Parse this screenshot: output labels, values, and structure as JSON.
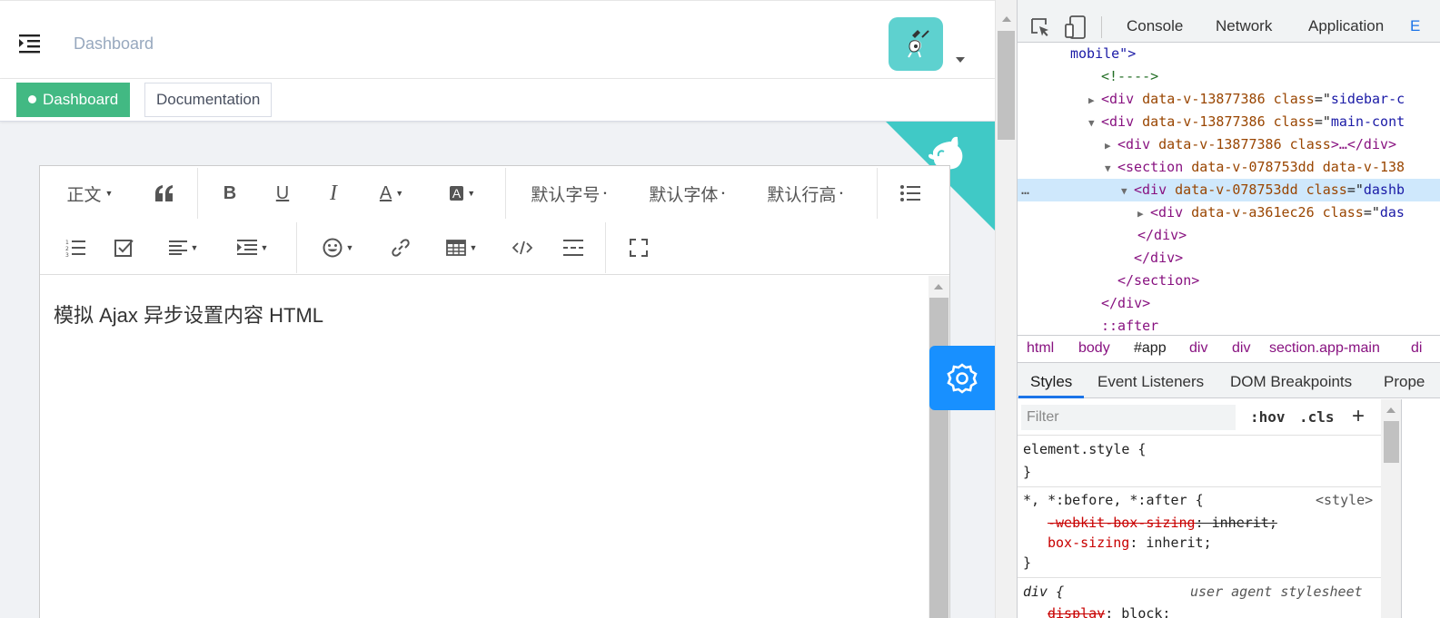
{
  "navbar": {
    "breadcrumb": "Dashboard"
  },
  "tags": {
    "items": [
      {
        "label": "Dashboard",
        "active": true
      },
      {
        "label": "Documentation",
        "active": false
      }
    ]
  },
  "editor": {
    "toolbar": {
      "heading": "正文",
      "quote_icon": "quote-icon",
      "bold": "B",
      "underline": "U",
      "italic": "I",
      "font_color": "A",
      "bg_color": "A",
      "font_size": "默认字号",
      "font_family": "默认字体",
      "line_height": "默认行高",
      "list_icon": "bullet-list-icon",
      "row2_icons": [
        "ordered-list-icon",
        "todo-icon",
        "justify-icon",
        "indent-icon",
        "emotion-icon",
        "link-icon",
        "table-icon",
        "code-icon",
        "divider-icon",
        "fullscreen-icon"
      ]
    },
    "content": "模拟 Ajax 异步设置内容 HTML"
  },
  "colors": {
    "accent_green": "#42b983",
    "settings_blue": "#1890ff",
    "github_teal": "#40c9c6",
    "avatar_bg": "#5ed1cf"
  },
  "devtools": {
    "tabs": [
      "Console",
      "Network",
      "Application",
      "E"
    ],
    "dom": [
      {
        "indent": 58,
        "text": "mobile\">"
      },
      {
        "indent": 92,
        "comment": "<!---->"
      },
      {
        "indent": 78,
        "tri": "▶",
        "tag": "div",
        "attr": "data-v-13877386 class",
        "val": "sidebar-c"
      },
      {
        "indent": 78,
        "tri": "▼",
        "tag": "div",
        "attr": "data-v-13877386 class",
        "val": "main-cont"
      },
      {
        "indent": 96,
        "tri": "▶",
        "tag": "div",
        "attr": "data-v-13877386 class",
        "tail": ">…</div>"
      },
      {
        "indent": 96,
        "tri": "▼",
        "tag": "section",
        "attr": "data-v-078753dd data-v-138",
        "val": ""
      },
      {
        "indent": 114,
        "tri": "▼",
        "tag": "div",
        "attr": "data-v-078753dd class",
        "val": "dashb",
        "selected": true
      },
      {
        "indent": 132,
        "tri": "▶",
        "tag": "div",
        "attr": "data-v-a361ec26 class",
        "val": "das"
      },
      {
        "indent": 132,
        "close": "</div>"
      },
      {
        "indent": 128,
        "close": "</div>"
      },
      {
        "indent": 110,
        "close": "</section>"
      },
      {
        "indent": 92,
        "close": "</div>"
      },
      {
        "indent": 92,
        "pseudo": "::after"
      }
    ],
    "dom_dots": "…",
    "crumbs": [
      "html",
      "body",
      "#app",
      "div",
      "div",
      "section.app-main",
      "di"
    ],
    "styles_tabs": [
      "Styles",
      "Event Listeners",
      "DOM Breakpoints",
      "Prope"
    ],
    "filter_placeholder": "Filter",
    "hov": ":hov",
    "cls": ".cls",
    "add": "+",
    "rules": {
      "element_selector": "element.style {",
      "close": "}",
      "universal_selector": "*, *:before, *:after {",
      "universal_source": "<style>",
      "webkit_prop": "-webkit-box-sizing",
      "webkit_val": ": inherit;",
      "box_prop": "box-sizing",
      "box_val": ": inherit;",
      "div_selector": "div {",
      "div_source": "user agent stylesheet",
      "display_prop": "display",
      "display_val": ": block;"
    }
  }
}
